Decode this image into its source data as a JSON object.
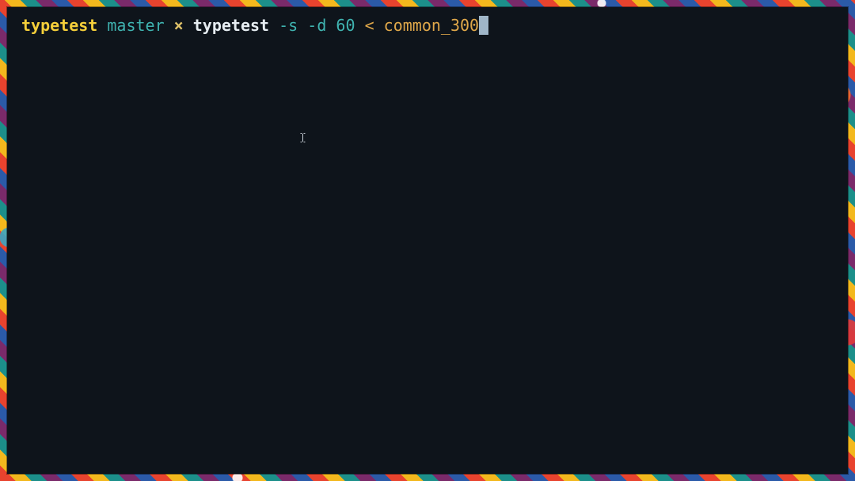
{
  "terminal": {
    "prompt": {
      "directory": "typetest",
      "branch": "master",
      "dirty_marker": "×"
    },
    "command": {
      "program": "typetest",
      "flag_s": "-s",
      "flag_d": "-d",
      "duration": "60",
      "redirect": "<",
      "input_file": "common_300"
    }
  },
  "colors": {
    "terminal_background": "#0e141b",
    "directory": "#f5cf3a",
    "branch": "#3fb3b0",
    "argument": "#e0a84a"
  }
}
